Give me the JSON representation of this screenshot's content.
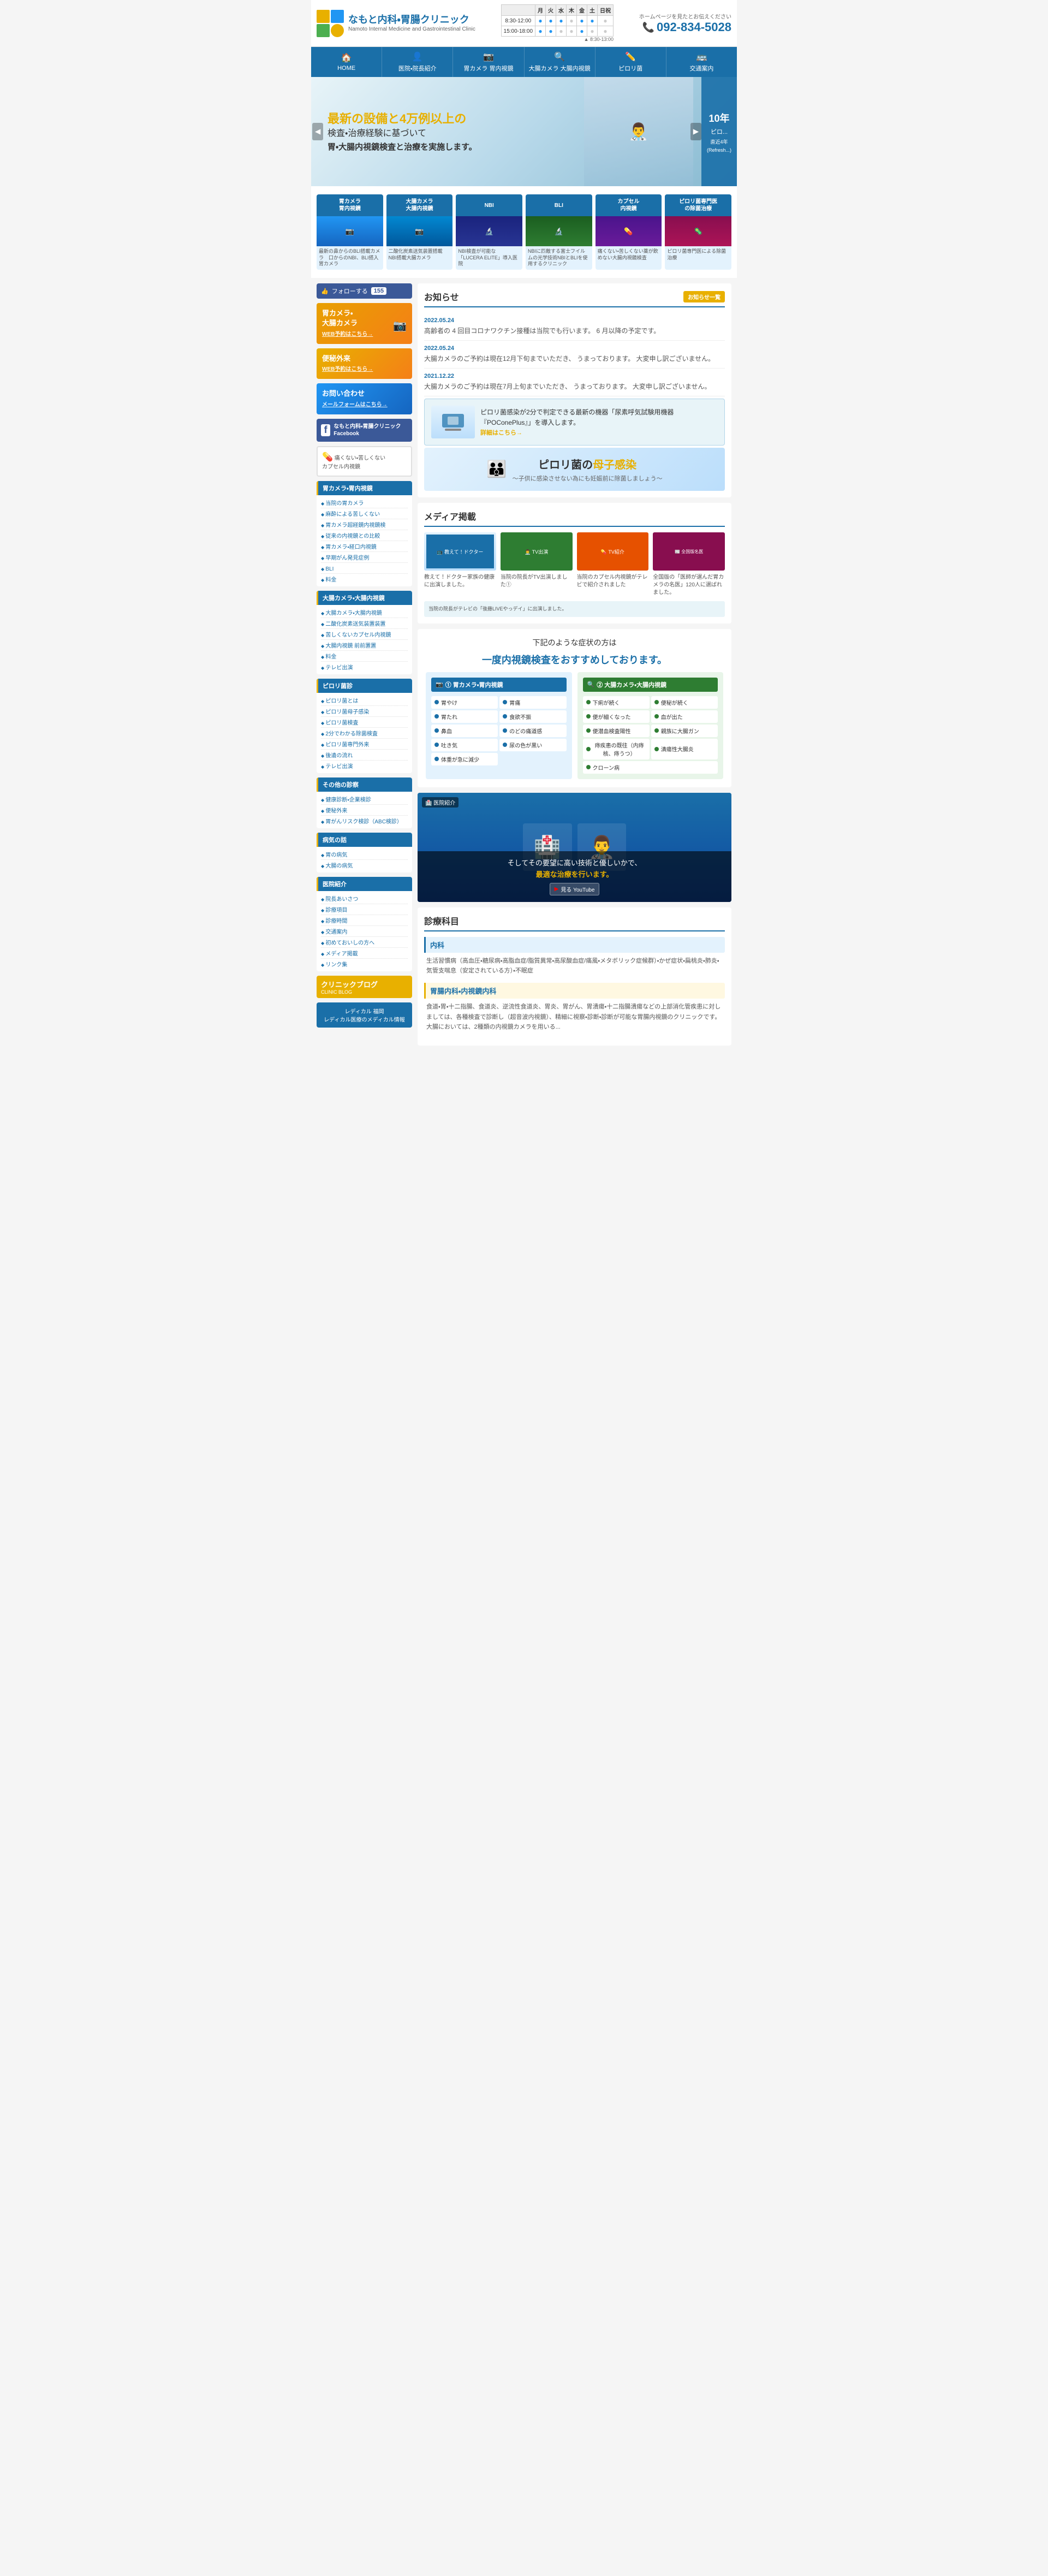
{
  "site": {
    "name": "なもと内科・胃腸クリニック",
    "name_en": "Namoto Internal Medicine and Gastrointestinal Clinic",
    "phone": "092-834-5028",
    "phone_label": "ホームページを見たとお伝えください",
    "hours": {
      "morning": "8:30-12:00",
      "afternoon": "15:00-18:00",
      "sub": "▲ 8:30-13:00"
    }
  },
  "nav": {
    "items": [
      {
        "label": "HOME",
        "icon": "🏠"
      },
      {
        "label": "医院・院長紹介",
        "icon": "👤"
      },
      {
        "label": "胃カメラ 胃内視鏡",
        "icon": "🔍"
      },
      {
        "label": "大腸カメラ 大腸内視鏡",
        "icon": "🔍"
      },
      {
        "label": "ピロリ菌",
        "icon": "✏️"
      },
      {
        "label": "交通案内",
        "icon": "🚌"
      }
    ]
  },
  "hero": {
    "highlight": "最新の設備と4万例以上の",
    "line1": "検査・治療経験に基づいて",
    "line2": "胃・大腸内視鏡検査と治療を実施します。",
    "badge_title": "10年",
    "badge_text": "ピロ..."
  },
  "service_cards": [
    {
      "title": "胃カメラ\n胃内視鏡",
      "desc": "最新の鼻からのBLI搭載カメラ　口からのNBI、BLI搭入胃カメラ"
    },
    {
      "title": "大腸カメラ\n大腸内視鏡",
      "desc": "二酸化炭素送気装置搭載　NBI搭載大腸カメラ"
    },
    {
      "title": "NBI",
      "desc": "NBI検査が可能な「LUCERA ELITE」導入医院"
    },
    {
      "title": "BLI",
      "desc": "NBIに匹敵する富士フイルムの光学技術NBIとBLIを使用するクリニック"
    },
    {
      "title": "カプセル\n内視鏡",
      "desc": "痛くない・苦しくない薬が飲めない大腸内視鏡検査"
    },
    {
      "title": "ピロリ菌専門医\nの除菌治療",
      "desc": "ピロリ菌専門医による除菌治療"
    }
  ],
  "sidebar": {
    "follow": {
      "label": "フォローする",
      "count": "155"
    },
    "banners": [
      {
        "id": "gastro",
        "title": "胃カメラ・\n大腸カメラ",
        "link": "WEB予約はこちら→"
      },
      {
        "id": "constipation",
        "title": "便秘外来",
        "link": "WEB予約はこちら→"
      },
      {
        "id": "contact",
        "title": "お問い合わせ",
        "link": "メールフォームはこちら→"
      }
    ],
    "facebook": {
      "label": "なもと内科・胃腸クリニック\nFacebook"
    },
    "capsule": {
      "text": "痛くない・苦しくない\nカプセル内視鏡"
    },
    "sections": [
      {
        "id": "gastro",
        "title": "胃カメラ・胃内視鏡",
        "items": [
          "当院の胃カメラ",
          "麻酔による苦しくない",
          "胃カメラ超経鏡内視鏡検",
          "従来の内視鏡との比較",
          "胃カメラ・経口内視鏡",
          "早期がん発見症例",
          "BLI",
          "料金"
        ]
      },
      {
        "id": "colon",
        "title": "大腸カメラ・大腸内視鏡",
        "items": [
          "大腸カメラ・大腸内視鏡",
          "二酸化炭素送気装置装置",
          "苦しくないカプセル内視鏡",
          "大腸内視鏡  前前置置",
          "料金",
          "テレビ出演"
        ]
      },
      {
        "id": "pylori",
        "title": "ピロリ菌診",
        "items": [
          "ピロリ菌とは",
          "ピロリ菌母子感染",
          "ピロリ菌検査",
          "2分でわかる除菌検査",
          "ピロリ菌専門外来",
          "後遺の流れ",
          "テレビ出演"
        ]
      },
      {
        "id": "other",
        "title": "その他の診察",
        "items": [
          "健康診断・企業検診",
          "便秘外来",
          "胃がんリスク検診（ABC検診）"
        ]
      },
      {
        "id": "illness",
        "title": "病気の話",
        "items": [
          "胃の病気",
          "大腸の病気"
        ]
      },
      {
        "id": "clinic",
        "title": "医院紹介",
        "items": [
          "院長あいさつ",
          "診療項目",
          "診療時間",
          "交通案内",
          "初めておいしの方へ",
          "メディア掲載",
          "リンク集"
        ]
      }
    ],
    "blog": {
      "title": "クリニックブログ",
      "subtitle": "CLINIC BLOG"
    },
    "radicle": {
      "text": "レディカル 福岡\nレディカル医療のメディカル情報"
    }
  },
  "notice": {
    "title": "お知らせ",
    "more_label": "お知らせ一覧",
    "items": [
      {
        "date": "2022.05.24",
        "text": "高齢者の 4 回目コロナワクチン接種は当院でも行います。 6 月以降の予定です。"
      },
      {
        "date": "2022.05.24",
        "text": "大腸カメラのご予約は現在12月下旬までいただき、 うまっております。 大変申し訳ございません。"
      },
      {
        "date": "2021.12.22",
        "text": "大腸カメラのご予約は現在7月上旬までいただき、 うまっております。 大変申し訳ございません。"
      }
    ]
  },
  "promo": {
    "text": "ピロリ菌感染が2分で判定できる最新の機器「尿素呼気試験用機器『POConePlus』」を導入します。",
    "link": "詳細はこちら→",
    "device_name": "POConePlus"
  },
  "pylori_banner": {
    "text": "ピロリ菌の",
    "highlight": "母子感染",
    "subtitle": "〜子供に感染させない為にも妊娠前に除菌しましょう〜"
  },
  "media": {
    "title": "メディア掲載",
    "cards": [
      {
        "text": "教えて！ドクター家族の健康に出演しました。"
      },
      {
        "text": "当院の院長がTV出演しました①"
      },
      {
        "text": "当院のカプセル内視鏡がテレビで紹介されました"
      },
      {
        "text": "全国版の「医師が選んだ胃カメラの名医」120人に選ばれました。"
      }
    ],
    "extra": {
      "text": "当院の院長がテレビの「後藤LIVEやっデイ」に出演しました。"
    }
  },
  "symptoms": {
    "title": "下記のような症状の方は",
    "highlight": "一度内視鏡検査をおすすめしております。",
    "gastro": {
      "title": "① 胃カメラ・胃内視鏡",
      "left": [
        "胃やけ",
        "胃たれ",
        "鼻血",
        "吐き気",
        "体重が急に減少"
      ],
      "right": [
        "胃痛",
        "食欲不振",
        "のどの痛道感",
        "尿の色が黒い"
      ]
    },
    "colon": {
      "title": "② 大腸カメラ・大腸内視鏡",
      "left": [
        "下痢が続く",
        "便が細くなった",
        "便潜血検査陽性",
        "痔疾患の既往（内痔核、痔うつ）"
      ],
      "right": [
        "便秘が続く",
        "血が出た",
        "親族に大腸ガン",
        "潰瘍性大腸炎",
        "クローン病"
      ]
    }
  },
  "video": {
    "label": "医院紹介",
    "caption1": "そしてその要望に高い技術と優しいかで、",
    "caption2": "最適な治療を行います。",
    "youtube": "見る YouTube"
  },
  "departments": {
    "title": "診療科目",
    "sections": [
      {
        "name": "内科",
        "text": "生活習慣病（高血圧・糖尿病・高脂血症/脂質異常・高尿酸血症/痛風・メタボリック症候群）・かぜ症状・扁桃炎・肺炎・気管支喘息（安定されている方）・不眠症"
      },
      {
        "name": "胃腸内科・内視鏡内科",
        "style": "gastro",
        "text": "食道・胃・十二指腸、食道炎、逆流性食道炎、胃炎、胃がん、胃潰瘍・十二指腸潰瘍などの上部消化管疾患に対しましては、各種検査で診断し（超音波内視鏡）、精細に視察・診断・診断が可能な胃腸内視鏡のクリニックです。大腸においては、2種類の内視鏡カメラを用いる..."
      }
    ]
  },
  "blog": {
    "title": "クリニックブログ",
    "subtitle": "CLINIC BLOG"
  }
}
